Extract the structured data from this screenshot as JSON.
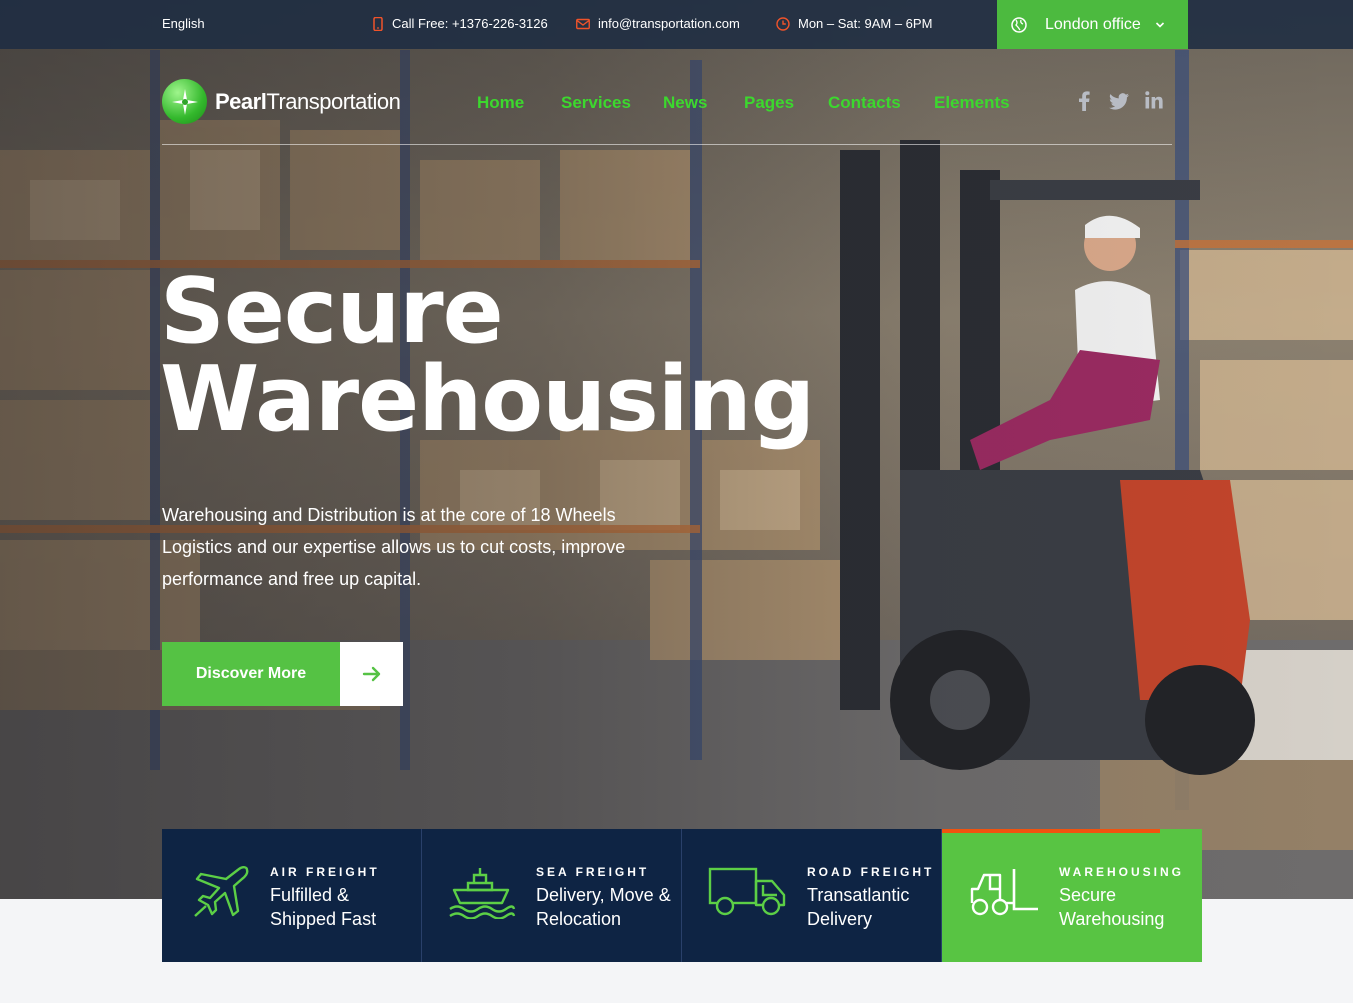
{
  "topbar": {
    "language": "English",
    "phone": "Call Free: +1376-226-3126",
    "email": "info@transportation.com",
    "hours": "Mon – Sat: 9AM – 6PM",
    "office": "London office"
  },
  "logo": {
    "bold": "Pearl",
    "light": "Transportation"
  },
  "nav": [
    "Home",
    "Services",
    "News",
    "Pages",
    "Contacts",
    "Elements"
  ],
  "social": [
    "facebook-icon",
    "twitter-icon",
    "linkedin-icon"
  ],
  "hero": {
    "title_line1": "Secure",
    "title_line2": "Warehousing",
    "description": "Warehousing and Distribution is at the core of 18 Wheels Logistics and our expertise allows us to cut costs, improve performance and free up capital.",
    "cta_label": "Discover More"
  },
  "services": [
    {
      "kicker": "AIR FREIGHT",
      "title": "Fulfilled & Shipped Fast",
      "icon": "airplane-icon",
      "active": false
    },
    {
      "kicker": "SEA FREIGHT",
      "title": "Delivery, Move & Relocation",
      "icon": "ship-icon",
      "active": false
    },
    {
      "kicker": "ROAD FREIGHT",
      "title": "Transatlantic Delivery",
      "icon": "truck-icon",
      "active": false
    },
    {
      "kicker": "WAREHOUSING",
      "title": "Secure Warehousing",
      "icon": "forklift-icon",
      "active": true
    }
  ],
  "colors": {
    "brand_green": "#4cba3f",
    "nav_green": "#3cd82e",
    "navy": "#0e2444",
    "accent_orange": "#f0530f"
  }
}
